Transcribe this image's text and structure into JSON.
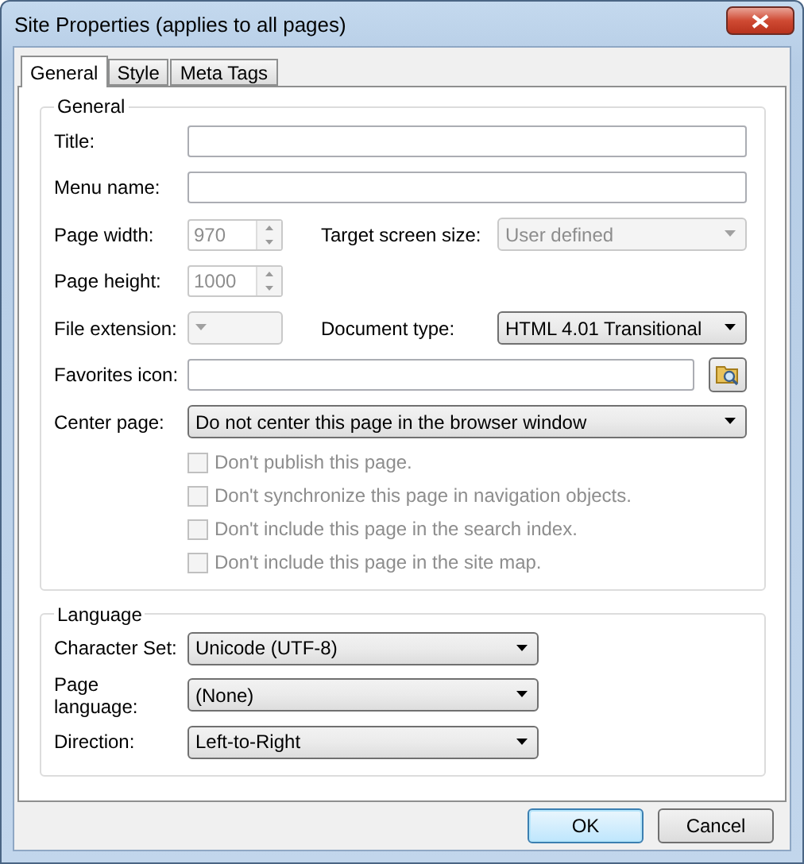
{
  "window": {
    "title": "Site Properties (applies to all pages)"
  },
  "tabs": [
    {
      "label": "General",
      "selected": true
    },
    {
      "label": "Style",
      "selected": false
    },
    {
      "label": "Meta Tags",
      "selected": false
    }
  ],
  "general": {
    "legend": "General",
    "title_field": {
      "label": "Title:"
    },
    "menu_name": {
      "label": "Menu name:"
    },
    "page_width": {
      "label": "Page width:",
      "value": "970",
      "disabled": true
    },
    "target_screen_size": {
      "label": "Target screen size:",
      "value": "User defined",
      "disabled": true
    },
    "page_height": {
      "label": "Page height:",
      "value": "1000",
      "disabled": true
    },
    "file_extension": {
      "label": "File extension:",
      "disabled": true
    },
    "document_type": {
      "label": "Document type:",
      "value": "HTML 4.01 Transitional",
      "disabled": false
    },
    "favorites_icon": {
      "label": "Favorites icon:"
    },
    "center_page": {
      "label": "Center page:",
      "value": "Do not center this page in the browser window",
      "disabled": false
    },
    "options": [
      {
        "label": "Don't publish this page.",
        "checked": false,
        "disabled": true
      },
      {
        "label": "Don't synchronize this page in navigation objects.",
        "checked": false,
        "disabled": true
      },
      {
        "label": "Don't include this page in the search index.",
        "checked": false,
        "disabled": true
      },
      {
        "label": "Don't include this page in the site map.",
        "checked": false,
        "disabled": true
      }
    ]
  },
  "language": {
    "legend": "Language",
    "fields": [
      {
        "label": "Character Set:",
        "value": "Unicode (UTF-8)"
      },
      {
        "label": "Page language:",
        "value": "(None)"
      },
      {
        "label": "Direction:",
        "value": "Left-to-Right"
      }
    ]
  },
  "buttons": [
    {
      "label": "OK",
      "default": true
    },
    {
      "label": "Cancel",
      "default": false
    }
  ]
}
